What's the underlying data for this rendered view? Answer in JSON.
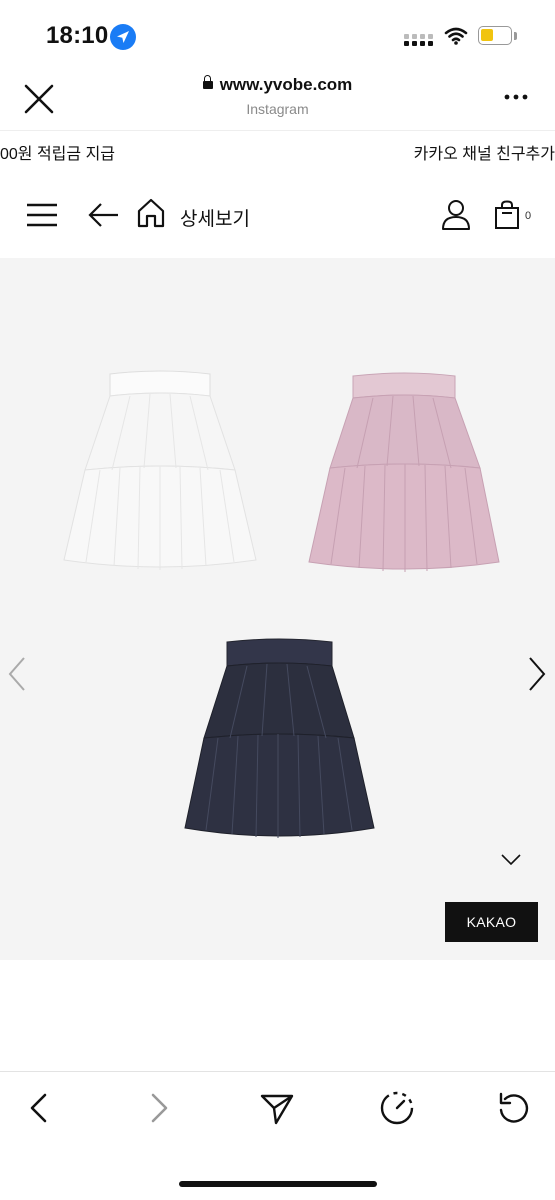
{
  "status_bar": {
    "time": "18:10",
    "icons": [
      "location-arrow-icon",
      "cellular-signal-icon",
      "wifi-icon",
      "battery-icon"
    ],
    "battery_color": "#f1c40f"
  },
  "browser": {
    "domain": "www.yvobe.com",
    "subtitle": "Instagram",
    "close_icon": "close-icon",
    "more_icon": "more-dots-icon"
  },
  "ticker": {
    "left_text": "00원 적립금 지급",
    "right_text": "카카오 채널 친구추가"
  },
  "site_nav": {
    "title": "상세보기",
    "cart_count": "0",
    "icons": [
      "hamburger-menu-icon",
      "back-arrow-icon",
      "home-icon",
      "user-icon",
      "shopping-bag-icon"
    ]
  },
  "product_gallery": {
    "items": [
      {
        "name": "white skirt",
        "color": "#f3f3f3"
      },
      {
        "name": "pink skirt",
        "color": "#d7b4c4"
      },
      {
        "name": "navy skirt",
        "color": "#2a2d3a"
      }
    ],
    "kakao_button_label": "KAKAO",
    "background": "#f4f4f4"
  },
  "toolbar": {
    "icons": [
      "back-icon",
      "forward-icon",
      "share-icon",
      "timer-icon",
      "reload-icon"
    ]
  }
}
